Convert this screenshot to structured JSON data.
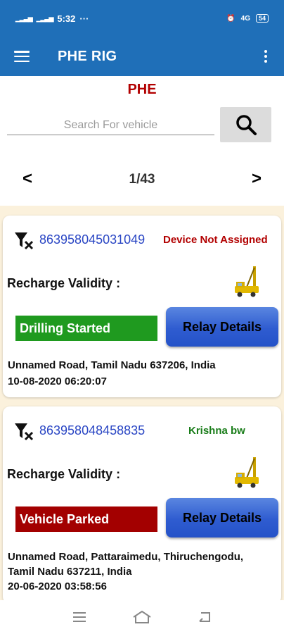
{
  "status_bar": {
    "time": "5:32",
    "more": "···",
    "signal": "4G",
    "battery": "54"
  },
  "app_bar": {
    "title": "PHE RIG"
  },
  "header": {
    "section_title": "PHE"
  },
  "search": {
    "placeholder": "Search For vehicle"
  },
  "pager": {
    "prev": "<",
    "next": ">",
    "page": "1/43"
  },
  "vehicles": [
    {
      "imei": "863958045031049",
      "status": "Device Not Assigned",
      "status_color": "#b20000",
      "recharge_label": "Recharge Validity :",
      "state": "Drilling Started",
      "state_color": "#1f9a1f",
      "relay_label": "Relay Details",
      "address_line1": "Unnamed Road, Tamil Nadu 637206, India",
      "timestamp": "10-08-2020 06:20:07"
    },
    {
      "imei": "863958048458835",
      "status": "Krishna bw",
      "status_color": "#1a7d1a",
      "recharge_label": "Recharge Validity :",
      "state": "Vehicle Parked",
      "state_color": "#a30000",
      "relay_label": "Relay Details",
      "address_line1": "Unnamed Road, Pattaraimedu, Thiruchengodu,",
      "address_line2": "Tamil Nadu 637211, India",
      "timestamp": "20-06-2020 03:58:56"
    }
  ],
  "icons": {
    "menu": "menu-icon",
    "overflow": "more-vert-icon",
    "search": "search-icon",
    "sim": "no-sim-icon",
    "rig": "drilling-rig-icon"
  }
}
